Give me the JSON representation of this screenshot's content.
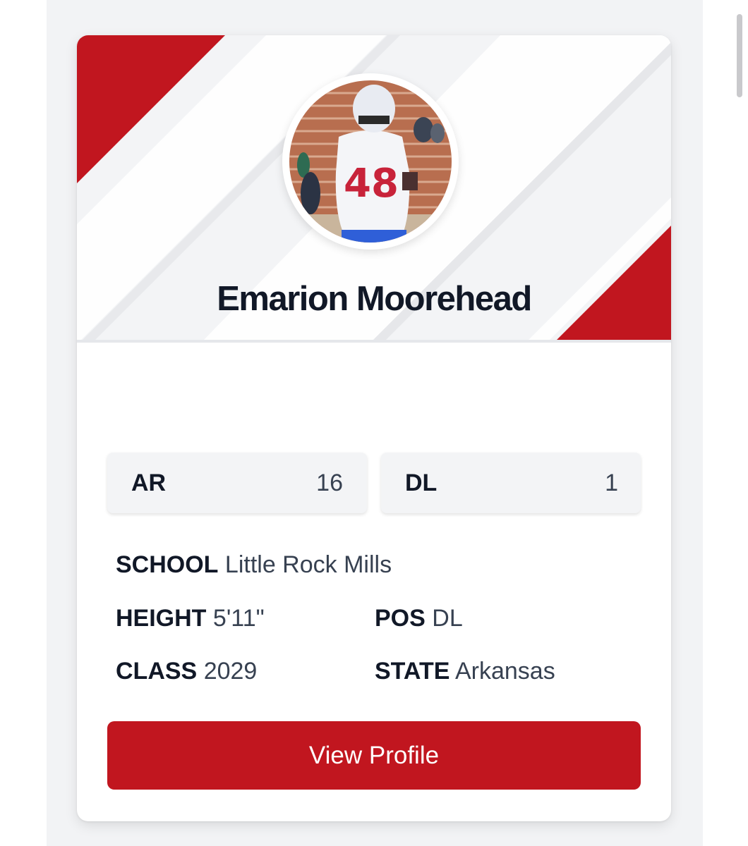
{
  "colors": {
    "accent": "#c1161f",
    "background": "#f2f3f5",
    "card": "#ffffff",
    "text_dark": "#111827"
  },
  "player": {
    "name": "Emarion Moorehead",
    "jersey_number": "48",
    "avatar_icon": "player-photo"
  },
  "rankings": [
    {
      "label": "AR",
      "value": "16"
    },
    {
      "label": "DL",
      "value": "1"
    }
  ],
  "details": {
    "school_label": "SCHOOL",
    "school_value": "Little Rock Mills",
    "height_label": "HEIGHT",
    "height_value": "5'11\"",
    "pos_label": "POS",
    "pos_value": "DL",
    "class_label": "CLASS",
    "class_value": "2029",
    "state_label": "STATE",
    "state_value": "Arkansas"
  },
  "actions": {
    "view_profile_label": "View Profile"
  }
}
